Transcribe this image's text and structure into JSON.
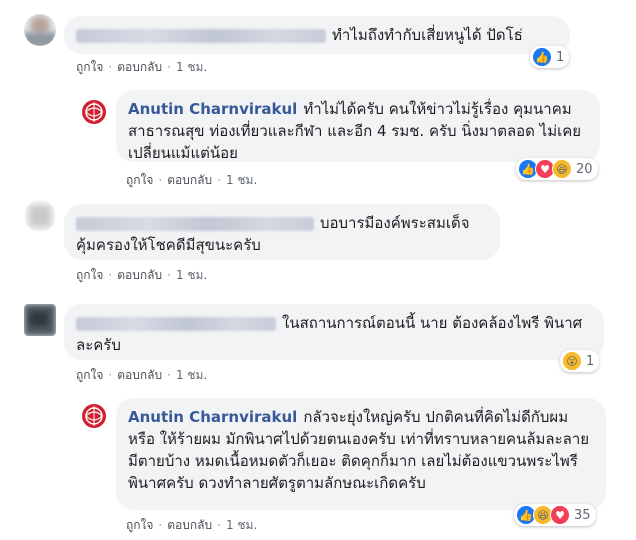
{
  "comments": [
    {
      "text": "ทำไมถึงทำกับเสี่ยหนูได้ ปัดโธ่",
      "like_label": "ถูกใจ",
      "reply_label": "ตอบกลับ",
      "time": "1 ชม.",
      "reaction_count": "1"
    },
    {
      "author": "Anutin Charnvirakul",
      "text": "ทำไม่ได้ครับ คนให้ข่าวไม่รู้เรื่อง คุมนาคม สาธารณสุข ท่องเที่ยวและกีฬา และอีก 4 รมช. ครับ นิ่งมาตลอด ไม่เคยเปลี่ยนแม้แต่น้อย",
      "like_label": "ถูกใจ",
      "reply_label": "ตอบกลับ",
      "time": "1 ชม.",
      "reaction_count": "20"
    },
    {
      "text": "บอบารมีองค์พระสมเด็จ คุ้มครองให้โชคดีมีสุขนะครับ",
      "like_label": "ถูกใจ",
      "reply_label": "ตอบกลับ",
      "time": "1 ชม."
    },
    {
      "text": "ในสถานการณ์ตอนนี้ นาย ต้องคล้องไพรี พินาศละครับ",
      "like_label": "ถูกใจ",
      "reply_label": "ตอบกลับ",
      "time": "1 ชม.",
      "reaction_count": "1"
    },
    {
      "author": "Anutin Charnvirakul",
      "text": "กลัวจะยุ่งใหญ่ครับ ปกติคนที่คิดไม่ดีกับผม หรือ ให้ร้ายผม มักพินาศไปด้วยตนเองครับ เท่าที่ทราบหลายคนล้มละลาย มีตายบ้าง หมดเนื้อหมดตัวก็เยอะ ติดคุกก็มาก เลยไม่ต้องแขวนพระไพรีพินาศครับ ดวงทำลายศัตรูตามลักษณะเกิดครับ",
      "like_label": "ถูกใจ",
      "reply_label": "ตอบกลับ",
      "time": "1 ชม.",
      "reaction_count": "35"
    }
  ],
  "colors": {
    "accent": "#385898",
    "bubble": "#f2f3f5",
    "like": "#1877f2",
    "love": "#f33e58",
    "haha": "#f7b928"
  }
}
